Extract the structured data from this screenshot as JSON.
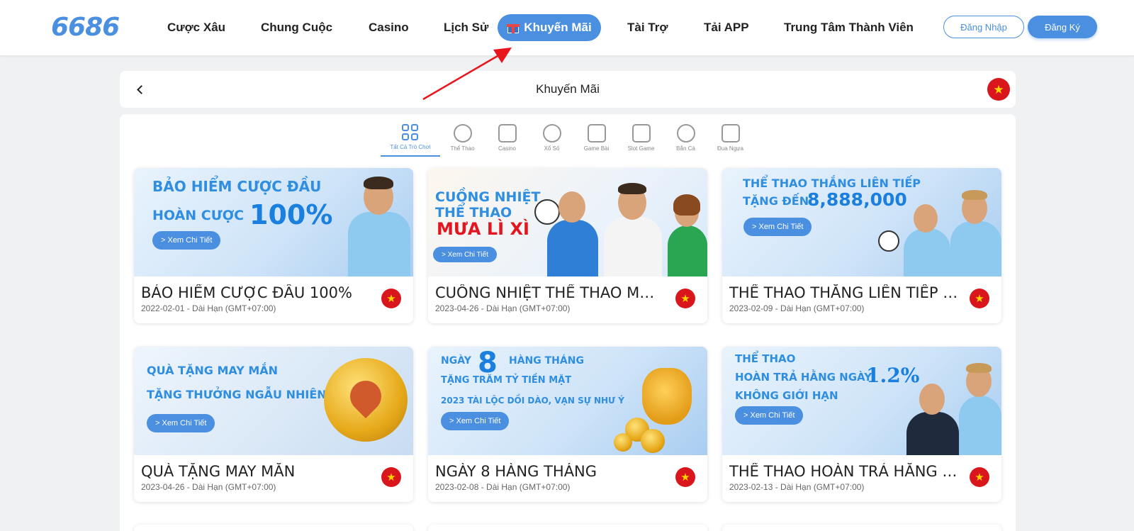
{
  "logo": "6686",
  "nav": {
    "items": [
      {
        "label": "Cược Xâu"
      },
      {
        "label": "Chung Cuộc"
      },
      {
        "label": "Casino"
      },
      {
        "label": "Lịch Sử"
      },
      {
        "label": "Khuyến Mãi",
        "active": true
      },
      {
        "label": "Tài Trợ"
      },
      {
        "label": "Tải APP"
      },
      {
        "label": "Trung Tâm Thành Viên"
      }
    ],
    "login": "Đăng Nhập",
    "register": "Đăng Ký"
  },
  "header": {
    "title": "Khuyến Mãi",
    "flag": "★"
  },
  "categories": [
    {
      "label": "Tất Cả Trò Chơi",
      "icon": "grid-icon",
      "active": true
    },
    {
      "label": "Thể Thao",
      "icon": "ball-icon"
    },
    {
      "label": "Casino",
      "icon": "cards-icon"
    },
    {
      "label": "Xổ Số",
      "icon": "lottery-icon"
    },
    {
      "label": "Game Bài",
      "icon": "card-game-icon"
    },
    {
      "label": "Slot Game",
      "icon": "slot-icon"
    },
    {
      "label": "Bắn Cá",
      "icon": "fish-icon"
    },
    {
      "label": "Đua Ngựa",
      "icon": "horse-icon"
    }
  ],
  "promos": [
    {
      "title": "BẢO HIỂM CƯỢC ĐẦU 100%",
      "date": "2022-02-01 - Dài Hạn (GMT+07:00)",
      "banner": {
        "line1": "BẢO HIỂM CƯỢC ĐẦU",
        "line2": "HOÀN CƯỢC",
        "big": "100%",
        "cta": "> Xem Chi Tiết"
      }
    },
    {
      "title": "CUỒNG NHIỆT THỂ THAO MƯ…",
      "date": "2023-04-26 - Dài Hạn (GMT+07:00)",
      "banner": {
        "line1": "CUỒNG NHIỆT",
        "line2": "THỂ THAO",
        "line3": "MƯA LÌ XÌ",
        "cta": "> Xem Chi Tiết"
      }
    },
    {
      "title": "THỂ THAO THẮNG LIÊN TIẾP T…",
      "date": "2023-02-09 - Dài Hạn (GMT+07:00)",
      "banner": {
        "line1": "THỂ THAO THẮNG LIÊN TIẾP",
        "line2": "TẶNG ĐẾN",
        "big": "8,888,000",
        "cta": "> Xem Chi Tiết"
      }
    },
    {
      "title": "QUÀ TẶNG MAY MẮN",
      "date": "2023-04-26 - Dài Hạn (GMT+07:00)",
      "banner": {
        "line1": "QUÀ TẶNG MAY MẮN",
        "line2": "TẶNG THƯỞNG NGẪU NHIÊN",
        "cta": "> Xem Chi Tiết"
      }
    },
    {
      "title": "NGÀY 8 HÀNG THÁNG",
      "date": "2023-02-08 - Dài Hạn (GMT+07:00)",
      "banner": {
        "pre": "NGÀY",
        "big": "8",
        "post": "HÀNG THÁNG",
        "line2": "TẶNG TRĂM TỶ TIỀN MẶT",
        "line3": "2023 TÀI LỘC DỒI DÀO, VẠN SỰ NHƯ Ý",
        "cta": "> Xem Chi Tiết"
      }
    },
    {
      "title": "THỂ THAO HOÀN TRẢ HẰNG N…",
      "date": "2023-02-13 - Dài Hạn (GMT+07:00)",
      "banner": {
        "line1": "THỂ THAO",
        "line2": "HOÀN TRẢ HẰNG NGÀY",
        "big": "1.2%",
        "line3": "KHÔNG GIỚI HẠN",
        "cta": "> Xem Chi Tiết"
      }
    }
  ]
}
